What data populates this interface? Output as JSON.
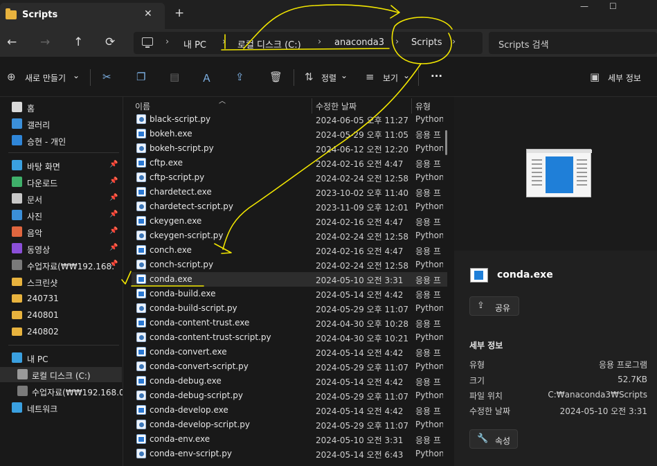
{
  "tab": {
    "title": "Scripts",
    "close": "✕",
    "new": "+"
  },
  "window": {
    "minimize": "—",
    "maximize": "☐"
  },
  "nav": {
    "back": "←",
    "forward": "→",
    "up": "↑",
    "refresh": "⟳"
  },
  "breadcrumb": [
    "내 PC",
    "로컬 디스크 (C:)",
    "anaconda3",
    "Scripts"
  ],
  "breadcrumb_sep": "›",
  "search": {
    "placeholder": "Scripts 검색"
  },
  "toolbar": {
    "new_label": "새로 만들기",
    "sort_label": "정렬",
    "view_label": "보기",
    "more_label": "···",
    "details_label": "세부 정보",
    "dropdown": "⌄"
  },
  "sidebar": {
    "quick": [
      {
        "label": "홈",
        "color": "#d9d9d9",
        "pinned": false
      },
      {
        "label": "갤러리",
        "color": "#3b8fd9",
        "pinned": false
      },
      {
        "label": "승현 - 개인",
        "color": "#2f86d8",
        "pinned": false
      }
    ],
    "pinned": [
      {
        "label": "바탕 화면",
        "color": "#3aa0e0",
        "pinned": true
      },
      {
        "label": "다운로드",
        "color": "#3fb06a",
        "pinned": true
      },
      {
        "label": "문서",
        "color": "#c8c8c8",
        "pinned": true
      },
      {
        "label": "사진",
        "color": "#3b8fd9",
        "pinned": true
      },
      {
        "label": "음악",
        "color": "#e0663f",
        "pinned": true
      },
      {
        "label": "동영상",
        "color": "#8b4fd8",
        "pinned": true
      },
      {
        "label": "수업자료(₩₩192.168.",
        "color": "#7a7a7a",
        "pinned": true
      },
      {
        "label": "스크린샷",
        "color": "#e8b33e",
        "pinned": false
      },
      {
        "label": "240731",
        "color": "#e8b33e",
        "pinned": false
      },
      {
        "label": "240801",
        "color": "#e8b33e",
        "pinned": false
      },
      {
        "label": "240802",
        "color": "#e8b33e",
        "pinned": false
      }
    ],
    "pc": [
      {
        "label": "내 PC",
        "color": "#3aa0e0",
        "indent": 0
      },
      {
        "label": "로컬 디스크 (C:)",
        "color": "#9a9a9a",
        "indent": 1
      },
      {
        "label": "수업자료(₩₩192.168.0.",
        "color": "#7a7a7a",
        "indent": 1
      },
      {
        "label": "네트워크",
        "color": "#3aa0e0",
        "indent": 0
      }
    ],
    "pin_glyph": "📌"
  },
  "columns": {
    "name": "이름",
    "date": "수정한 날짜",
    "type": "유형"
  },
  "files": [
    {
      "name": "black-script.py",
      "date": "2024-06-05 오후 11:27",
      "type": "Python",
      "kind": "py"
    },
    {
      "name": "bokeh.exe",
      "date": "2024-05-29 오후 11:05",
      "type": "응용 프",
      "kind": "exe"
    },
    {
      "name": "bokeh-script.py",
      "date": "2024-06-12 오전 12:20",
      "type": "Python",
      "kind": "py"
    },
    {
      "name": "cftp.exe",
      "date": "2024-02-16 오전 4:47",
      "type": "응용 프",
      "kind": "exe"
    },
    {
      "name": "cftp-script.py",
      "date": "2024-02-24 오전 12:58",
      "type": "Python",
      "kind": "py"
    },
    {
      "name": "chardetect.exe",
      "date": "2023-10-02 오후 11:40",
      "type": "응용 프",
      "kind": "exe"
    },
    {
      "name": "chardetect-script.py",
      "date": "2023-11-09 오후 12:01",
      "type": "Python",
      "kind": "py"
    },
    {
      "name": "ckeygen.exe",
      "date": "2024-02-16 오전 4:47",
      "type": "응용 프",
      "kind": "exe"
    },
    {
      "name": "ckeygen-script.py",
      "date": "2024-02-24 오전 12:58",
      "type": "Python",
      "kind": "py"
    },
    {
      "name": "conch.exe",
      "date": "2024-02-16 오전 4:47",
      "type": "응용 프",
      "kind": "exe"
    },
    {
      "name": "conch-script.py",
      "date": "2024-02-24 오전 12:58",
      "type": "Python",
      "kind": "py"
    },
    {
      "name": "conda.exe",
      "date": "2024-05-10 오전 3:31",
      "type": "응용 프",
      "kind": "exe",
      "selected": true
    },
    {
      "name": "conda-build.exe",
      "date": "2024-05-14 오전 4:42",
      "type": "응용 프",
      "kind": "exe"
    },
    {
      "name": "conda-build-script.py",
      "date": "2024-05-29 오후 11:07",
      "type": "Python",
      "kind": "py"
    },
    {
      "name": "conda-content-trust.exe",
      "date": "2024-04-30 오후 10:28",
      "type": "응용 프",
      "kind": "exe"
    },
    {
      "name": "conda-content-trust-script.py",
      "date": "2024-04-30 오후 10:21",
      "type": "Python",
      "kind": "py"
    },
    {
      "name": "conda-convert.exe",
      "date": "2024-05-14 오전 4:42",
      "type": "응용 프",
      "kind": "exe"
    },
    {
      "name": "conda-convert-script.py",
      "date": "2024-05-29 오후 11:07",
      "type": "Python",
      "kind": "py"
    },
    {
      "name": "conda-debug.exe",
      "date": "2024-05-14 오전 4:42",
      "type": "응용 프",
      "kind": "exe"
    },
    {
      "name": "conda-debug-script.py",
      "date": "2024-05-29 오후 11:07",
      "type": "Python",
      "kind": "py"
    },
    {
      "name": "conda-develop.exe",
      "date": "2024-05-14 오전 4:42",
      "type": "응용 프",
      "kind": "exe"
    },
    {
      "name": "conda-develop-script.py",
      "date": "2024-05-29 오후 11:07",
      "type": "Python",
      "kind": "py"
    },
    {
      "name": "conda-env.exe",
      "date": "2024-05-10 오전 3:31",
      "type": "응용 프",
      "kind": "exe"
    },
    {
      "name": "conda-env-script.py",
      "date": "2024-05-14 오전 6:43",
      "type": "Python",
      "kind": "py"
    }
  ],
  "details": {
    "filename": "conda.exe",
    "share_label": "공유",
    "section_title": "세부 정보",
    "props": [
      {
        "key": "유형",
        "value": "응용 프로그램"
      },
      {
        "key": "크기",
        "value": "52.7KB"
      },
      {
        "key": "파일 위치",
        "value": "C:₩anaconda3₩Scripts"
      },
      {
        "key": "수정한 날짜",
        "value": "2024-05-10 오전 3:31"
      }
    ],
    "props_label": "속성"
  },
  "annotation_color": "#f2e600"
}
